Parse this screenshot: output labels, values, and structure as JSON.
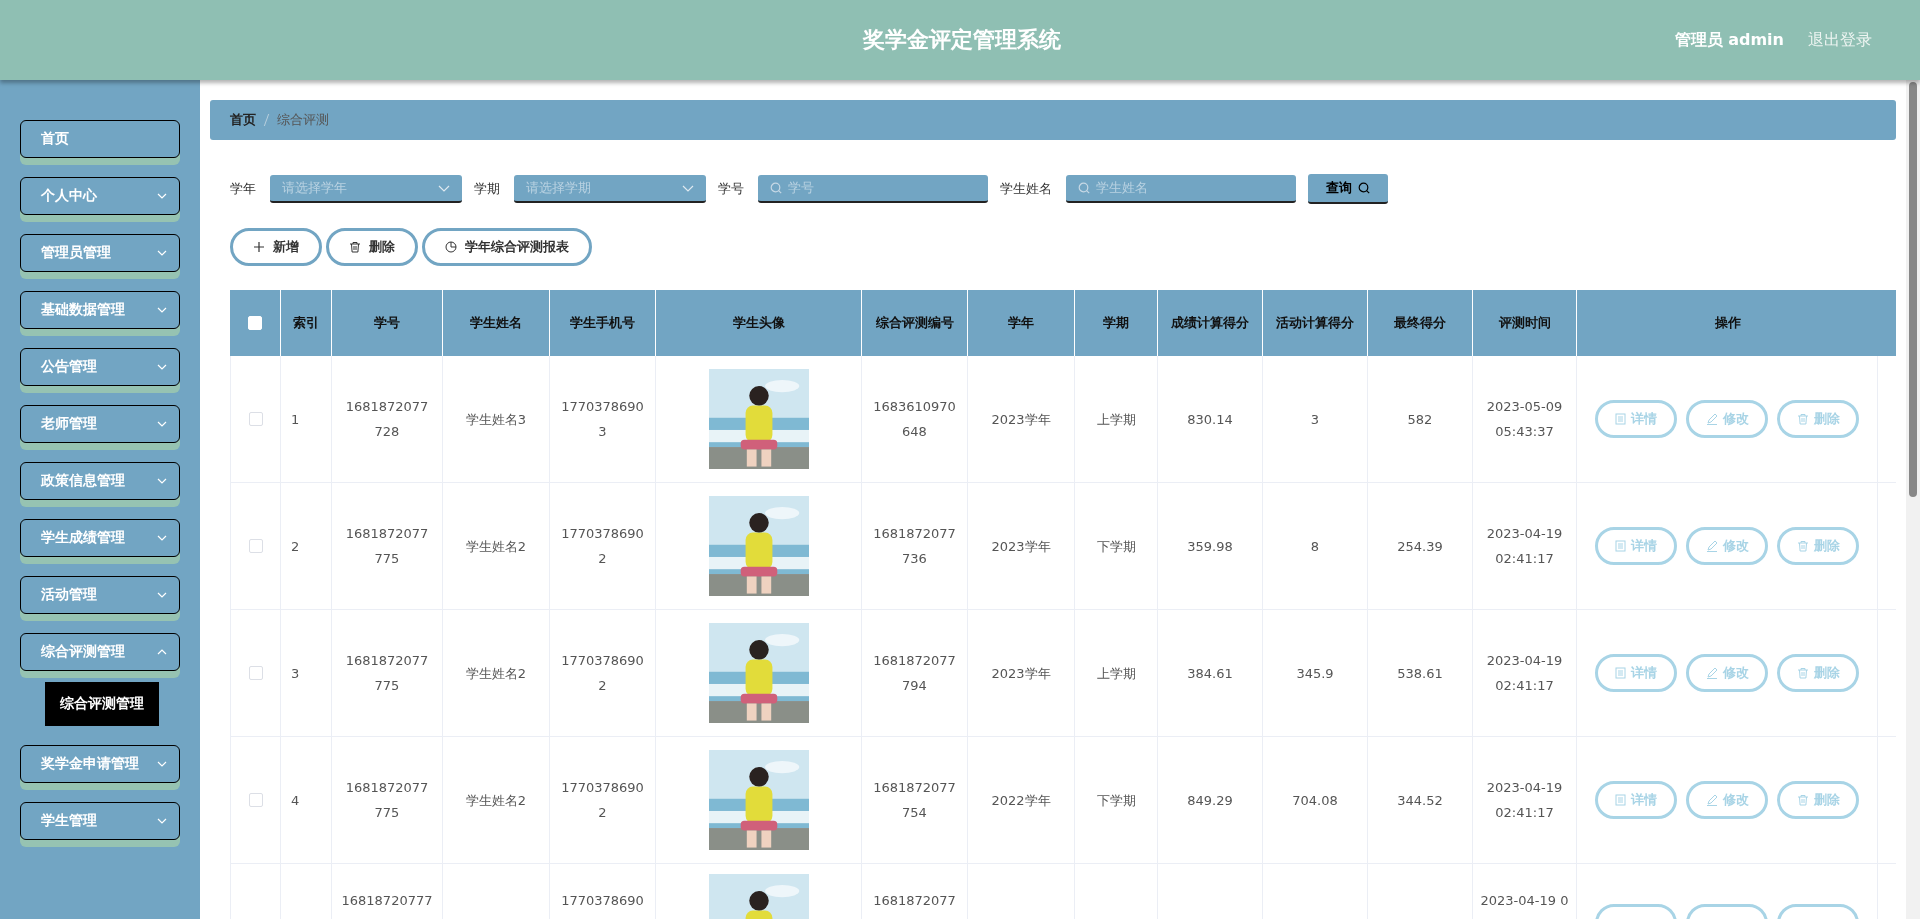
{
  "header": {
    "title": "奖学金评定管理系统",
    "user": "管理员 admin",
    "logout": "退出登录"
  },
  "sidebar": {
    "items": [
      {
        "label": "首页",
        "kind": "link"
      },
      {
        "label": "个人中心",
        "kind": "submenu",
        "expanded": false
      },
      {
        "label": "管理员管理",
        "kind": "submenu",
        "expanded": false
      },
      {
        "label": "基础数据管理",
        "kind": "submenu",
        "expanded": false
      },
      {
        "label": "公告管理",
        "kind": "submenu",
        "expanded": false
      },
      {
        "label": "老师管理",
        "kind": "submenu",
        "expanded": false
      },
      {
        "label": "政策信息管理",
        "kind": "submenu",
        "expanded": false
      },
      {
        "label": "学生成绩管理",
        "kind": "submenu",
        "expanded": false
      },
      {
        "label": "活动管理",
        "kind": "submenu",
        "expanded": false
      },
      {
        "label": "综合评测管理",
        "kind": "submenu",
        "expanded": true,
        "children": [
          {
            "label": "综合评测管理"
          }
        ]
      },
      {
        "label": "奖学金申请管理",
        "kind": "submenu",
        "expanded": false
      },
      {
        "label": "学生管理",
        "kind": "submenu",
        "expanded": false
      }
    ]
  },
  "breadcrumb": [
    "首页",
    "综合评测"
  ],
  "filters": [
    {
      "label": "学年",
      "kind": "select",
      "placeholder": "请选择学年"
    },
    {
      "label": "学期",
      "kind": "select",
      "placeholder": "请选择学期"
    },
    {
      "label": "学号",
      "kind": "search",
      "placeholder": "学号"
    },
    {
      "label": "学生姓名",
      "kind": "search",
      "placeholder": "学生姓名"
    }
  ],
  "query_button": "查询",
  "actions": [
    {
      "label": "新增",
      "kind": "add"
    },
    {
      "label": "删除",
      "kind": "delete"
    },
    {
      "label": "学年综合评测报表",
      "kind": "report"
    }
  ],
  "table": {
    "header_checked": false,
    "columns": [
      "索引",
      "学号",
      "学生姓名",
      "学生手机号",
      "学生头像",
      "综合评测编号",
      "学年",
      "学期",
      "成绩计算得分",
      "活动计算得分",
      "最终得分",
      "评测时间",
      "操作"
    ],
    "rows": [
      {
        "checked": false,
        "cells": [
          "1",
          "1681872077728",
          "学生姓名3",
          "17703786903",
          {
            "kind": "picture"
          },
          "1683610970648",
          "2023学年",
          "上学期",
          "830.14",
          "3",
          "582",
          "2023-05-09 05:43:37"
        ],
        "actions": [
          {
            "label": "详情",
            "kind": "detail"
          },
          {
            "label": "修改",
            "kind": "edit"
          },
          {
            "label": "删除",
            "kind": "delete"
          }
        ]
      },
      {
        "checked": false,
        "cells": [
          "2",
          "1681872077775",
          "学生姓名2",
          "17703786902",
          {
            "kind": "picture"
          },
          "1681872077736",
          "2023学年",
          "下学期",
          "359.98",
          "8",
          "254.39",
          "2023-04-19 02:41:17"
        ],
        "actions": [
          {
            "label": "详情",
            "kind": "detail"
          },
          {
            "label": "修改",
            "kind": "edit"
          },
          {
            "label": "删除",
            "kind": "delete"
          }
        ]
      },
      {
        "checked": false,
        "cells": [
          "3",
          "1681872077775",
          "学生姓名2",
          "17703786902",
          {
            "kind": "picture"
          },
          "1681872077794",
          "2023学年",
          "上学期",
          "384.61",
          "345.9",
          "538.61",
          "2023-04-19 02:41:17"
        ],
        "actions": [
          {
            "label": "详情",
            "kind": "detail"
          },
          {
            "label": "修改",
            "kind": "edit"
          },
          {
            "label": "删除",
            "kind": "delete"
          }
        ]
      },
      {
        "checked": false,
        "cells": [
          "4",
          "1681872077775",
          "学生姓名2",
          "17703786902",
          {
            "kind": "picture"
          },
          "1681872077754",
          "2022学年",
          "下学期",
          "849.29",
          "704.08",
          "344.52",
          "2023-04-19 02:41:17"
        ],
        "actions": [
          {
            "label": "详情",
            "kind": "detail"
          },
          {
            "label": "修改",
            "kind": "edit"
          },
          {
            "label": "删除",
            "kind": "delete"
          }
        ]
      },
      {
        "cells": [
          "",
          "16818720777",
          "",
          "1770378690",
          {
            "kind": "picture"
          },
          "1681872077",
          "",
          "",
          "",
          "",
          "",
          "2023-04-19 0"
        ]
      }
    ]
  }
}
